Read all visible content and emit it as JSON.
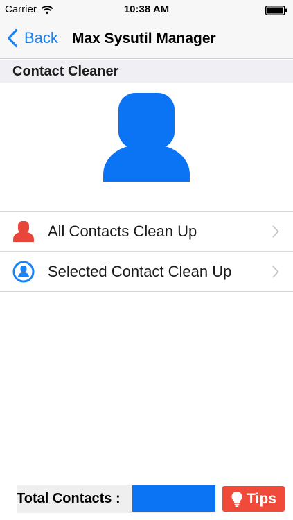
{
  "status_bar": {
    "carrier": "Carrier",
    "time": "10:38 AM",
    "icons": [
      "wifi-icon",
      "battery-icon"
    ]
  },
  "nav": {
    "back_label": "Back",
    "title": "Max Sysutil Manager",
    "accent_color": "#1a82f7"
  },
  "section": {
    "title": "Contact Cleaner"
  },
  "hero": {
    "icon": "person-icon",
    "color": "#0a74f5"
  },
  "list": {
    "items": [
      {
        "label": "All Contacts Clean Up",
        "icon": "person-red-icon",
        "chevron": "chevron-right-icon"
      },
      {
        "label": "Selected Contact Clean Up",
        "icon": "person-circle-icon",
        "chevron": "chevron-right-icon"
      }
    ]
  },
  "footer": {
    "total_label": "Total Contacts :",
    "total_value": "",
    "tips_label": "Tips",
    "tips_icon": "lightbulb-icon",
    "tips_color": "#f04a3b"
  }
}
